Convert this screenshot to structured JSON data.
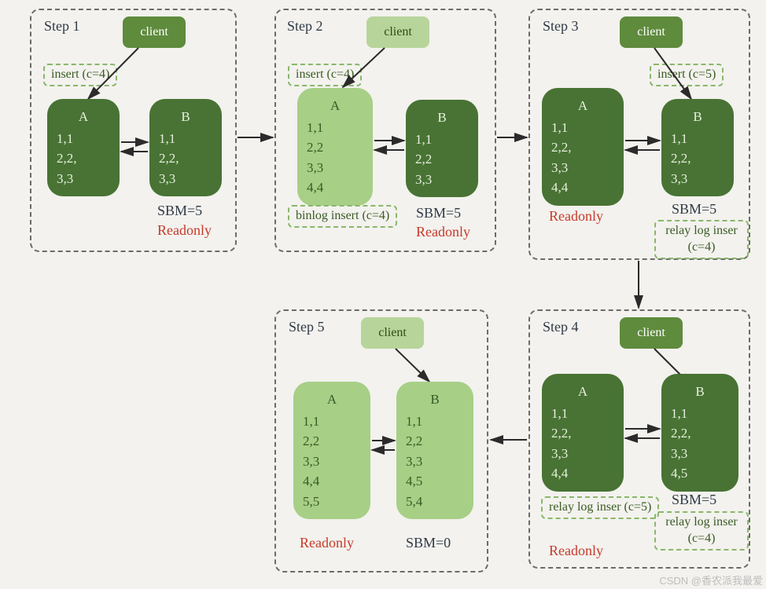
{
  "watermark": "CSDN @香农派我最爱",
  "steps": {
    "s1": {
      "title": "Step 1",
      "client": "client",
      "insert_note": "insert (c=4)",
      "A": {
        "name": "A",
        "rows": [
          "1,1",
          "2,2,",
          "3,3"
        ]
      },
      "B": {
        "name": "B",
        "rows": [
          "1,1",
          "2,2,",
          "3,3"
        ]
      },
      "sbm": "SBM=5",
      "readonly": "Readonly"
    },
    "s2": {
      "title": "Step 2",
      "client": "client",
      "insert_note": "insert (c=4)",
      "A": {
        "name": "A",
        "rows": [
          "1,1",
          "2,2",
          "3,3",
          "4,4"
        ]
      },
      "B": {
        "name": "B",
        "rows": [
          "1,1",
          "2,2",
          "3,3"
        ]
      },
      "binlog": "binlog\ninsert (c=4)",
      "sbm": "SBM=5",
      "readonly": "Readonly"
    },
    "s3": {
      "title": "Step 3",
      "client": "client",
      "insert_note": "insert (c=5)",
      "A": {
        "name": "A",
        "rows": [
          "1,1",
          "2,2,",
          "3,3",
          "4,4"
        ]
      },
      "B": {
        "name": "B",
        "rows": [
          "1,1",
          "2,2,",
          "3,3"
        ]
      },
      "relay": "relay log\ninser (c=4)",
      "sbm": "SBM=5",
      "readonly": "Readonly"
    },
    "s4": {
      "title": "Step 4",
      "client": "client",
      "A": {
        "name": "A",
        "rows": [
          "1,1",
          "2,2,",
          "3,3",
          "4,4"
        ]
      },
      "B": {
        "name": "B",
        "rows": [
          "1,1",
          "2,2,",
          "3,3",
          "4,5"
        ]
      },
      "relayA": "relay log\ninser (c=5)",
      "relayB": "relay log\ninser (c=4)",
      "sbm": "SBM=5",
      "readonly": "Readonly"
    },
    "s5": {
      "title": "Step 5",
      "client": "client",
      "A": {
        "name": "A",
        "rows": [
          "1,1",
          "2,2",
          "3,3",
          "4,4",
          "5,5"
        ]
      },
      "B": {
        "name": "B",
        "rows": [
          "1,1",
          "2,2",
          "3,3",
          "4,5",
          "5,4"
        ]
      },
      "sbm": "SBM=0",
      "readonly": "Readonly"
    }
  }
}
